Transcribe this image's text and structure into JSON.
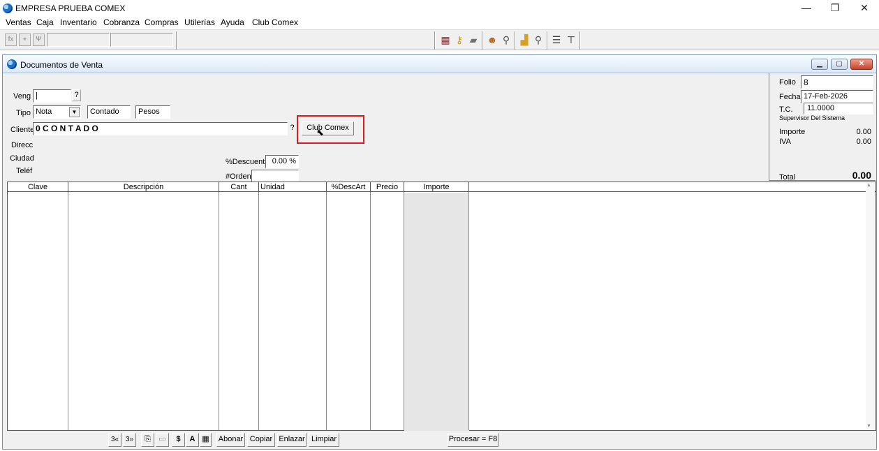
{
  "app": {
    "title": "EMPRESA PRUEBA COMEX",
    "controls": {
      "minimize": "—",
      "restore": "❐",
      "close": "✕"
    }
  },
  "menu": [
    "Ventas",
    "Caja",
    "Inventario",
    "Cobranza",
    "Compras",
    "Utilerías",
    "Ayuda",
    "Club Comex"
  ],
  "toolbar": {
    "left_buttons": [
      "fx",
      "⌖",
      "Ψ"
    ],
    "right_icons": [
      "calculator-icon",
      "key-icon",
      "folder-icon",
      "user-icon",
      "search-icon",
      "boxes-icon",
      "search-icon",
      "list-icon",
      "exit-icon"
    ]
  },
  "window": {
    "title": "Documentos de Venta",
    "controls": {
      "minimize": "▁",
      "restore": "▢",
      "close": "✕"
    }
  },
  "form": {
    "veng_label": "Veng",
    "veng_value": "|",
    "help_q": "?",
    "tipo_label": "Tipo",
    "tipo_value": "Nota",
    "contado": "Contado",
    "pesos": "Pesos",
    "cliente_label": "Cliente",
    "cliente_value": "0 C O N T A D O",
    "club_button": "Club Comex",
    "direcc_label": "Direcc",
    "ciudad_label": "Ciudad",
    "telef_label": "Teléf",
    "descuento_label": "%Descuent",
    "descuento_value": "0.00 %",
    "orden_label": "#Orden",
    "orden_value": ""
  },
  "summary": {
    "folio_label": "Folio",
    "folio_value": "8",
    "fecha_label": "Fecha",
    "fecha_value": "17-Feb-2026",
    "tc_label": "T.C.",
    "tc_value": "11.0000",
    "supervisor": "Supervisor Del Sistema",
    "importe_label": "Importe",
    "importe_value": "0.00",
    "iva_label": "IVA",
    "iva_value": "0.00",
    "total_label": "Total",
    "total_value": "0.00"
  },
  "grid": {
    "columns": [
      "Clave",
      "Descripción",
      "Cant",
      "Unidad",
      "%DescArt",
      "Precio",
      "Importe"
    ]
  },
  "bottom": {
    "icon_buttons": [
      "3«",
      "3»",
      "⎘",
      "▭",
      "$",
      "A",
      "▦"
    ],
    "abonar": "Abonar",
    "copiar": "Copiar",
    "enlazar": "Enlazar",
    "limpiar": "Limpiar",
    "procesar": "Procesar = F8"
  },
  "colors": {
    "highlight": "#e0191f",
    "title_gradient_top": "#f7fbff",
    "title_gradient_bottom": "#dbe8f6"
  }
}
